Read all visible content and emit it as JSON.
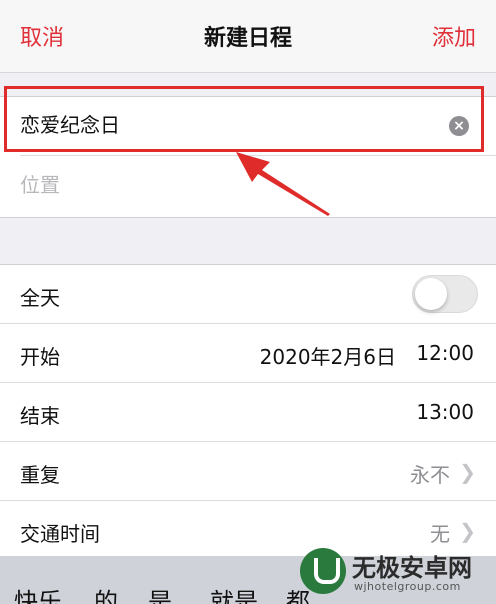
{
  "navbar": {
    "cancel_label": "取消",
    "title": "新建日程",
    "add_label": "添加"
  },
  "event": {
    "title_value": "恋爱纪念日",
    "location_placeholder": "位置"
  },
  "details": {
    "all_day_label": "全天",
    "all_day_on": false,
    "start_label": "开始",
    "start_date": "2020年2月6日",
    "start_time": "12:00",
    "end_label": "结束",
    "end_time": "13:00",
    "repeat_label": "重复",
    "repeat_value": "永不",
    "travel_label": "交通时间",
    "travel_value": "无"
  },
  "keyboard_suggestions": [
    "快乐",
    "的",
    "是",
    "就是",
    "都"
  ],
  "watermark": {
    "name": "无极安卓网",
    "url": "wjhotelgroup.com"
  },
  "colors": {
    "accent": "#e0303a",
    "highlight": "#e02b2b",
    "toggle_off": "#e9e9ea"
  }
}
